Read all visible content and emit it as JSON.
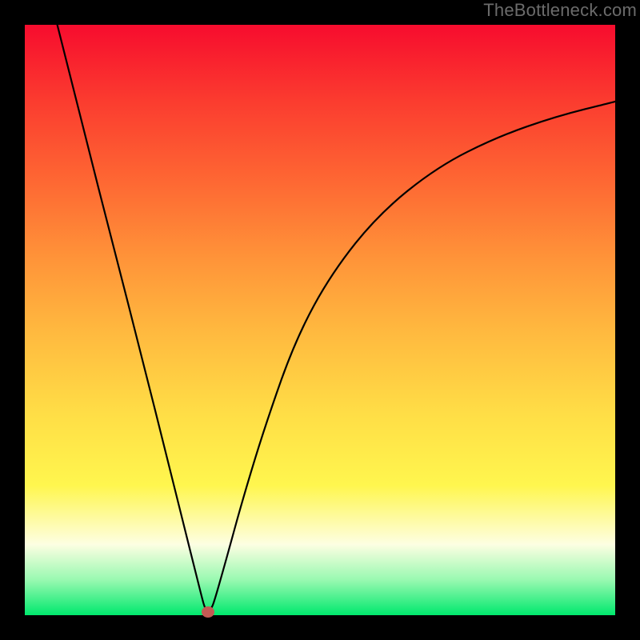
{
  "watermark": {
    "text": "TheBottleneck.com"
  },
  "chart_data": {
    "type": "line",
    "title": "",
    "xlabel": "",
    "ylabel": "",
    "xlim": [
      0,
      100
    ],
    "ylim": [
      0,
      100
    ],
    "background": {
      "gradient": "vertical",
      "stops": [
        {
          "pos": 0.0,
          "color": "#f70c2e"
        },
        {
          "pos": 0.13,
          "color": "#fb3c2f"
        },
        {
          "pos": 0.27,
          "color": "#fe6933"
        },
        {
          "pos": 0.4,
          "color": "#ff9539"
        },
        {
          "pos": 0.52,
          "color": "#ffb93f"
        },
        {
          "pos": 0.66,
          "color": "#ffde46"
        },
        {
          "pos": 0.78,
          "color": "#fff64e"
        },
        {
          "pos": 0.88,
          "color": "#fdfee2"
        },
        {
          "pos": 0.94,
          "color": "#99f9b1"
        },
        {
          "pos": 1.0,
          "color": "#00e86d"
        }
      ]
    },
    "series": [
      {
        "name": "bottleneck-curve",
        "color": "#000000",
        "x": [
          5.5,
          10,
          15,
          20,
          24,
          27,
          29,
          30,
          30.5,
          31,
          31.5,
          32,
          34,
          37,
          41,
          46,
          52,
          60,
          70,
          80,
          90,
          100
        ],
        "y": [
          100,
          82,
          62.5,
          43,
          27,
          15,
          7,
          3,
          1.2,
          0.5,
          1,
          2,
          9,
          20,
          33,
          47,
          58,
          68,
          76,
          81,
          84.5,
          87
        ]
      }
    ],
    "marker": {
      "x": 31,
      "y": 0.5,
      "color": "#c45a54"
    },
    "grid": false,
    "legend": false
  }
}
